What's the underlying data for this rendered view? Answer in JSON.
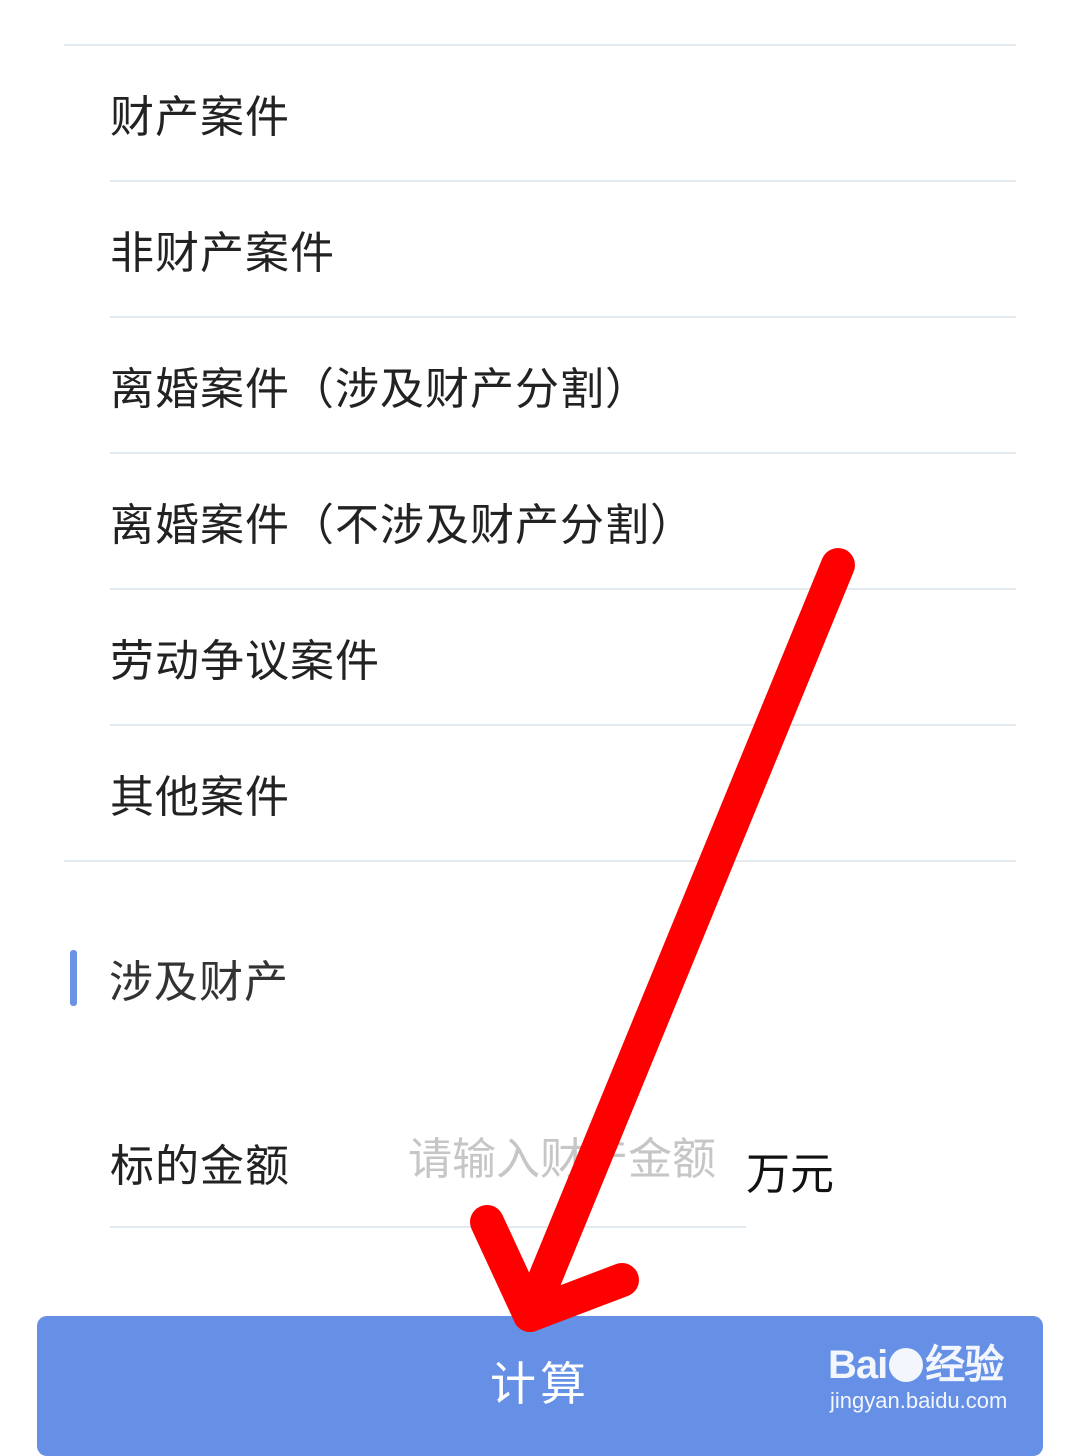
{
  "case_types": [
    {
      "label": "财产案件"
    },
    {
      "label": "非财产案件"
    },
    {
      "label": "离婚案件（涉及财产分割）"
    },
    {
      "label": "离婚案件（不涉及财产分割）"
    },
    {
      "label": "劳动争议案件"
    },
    {
      "label": "其他案件"
    }
  ],
  "section": {
    "title": "涉及财产"
  },
  "amount": {
    "label": "标的金额",
    "placeholder": "请输入财产金额",
    "value": "",
    "unit": "万元"
  },
  "calculate": {
    "label": "计算"
  },
  "watermark": {
    "brand_left": "Bai",
    "brand_right": "经验",
    "url": "jingyan.baidu.com"
  },
  "colors": {
    "accent": "#6690e6",
    "divider": "#e3eaf0",
    "annotation_arrow": "#ff0000"
  }
}
